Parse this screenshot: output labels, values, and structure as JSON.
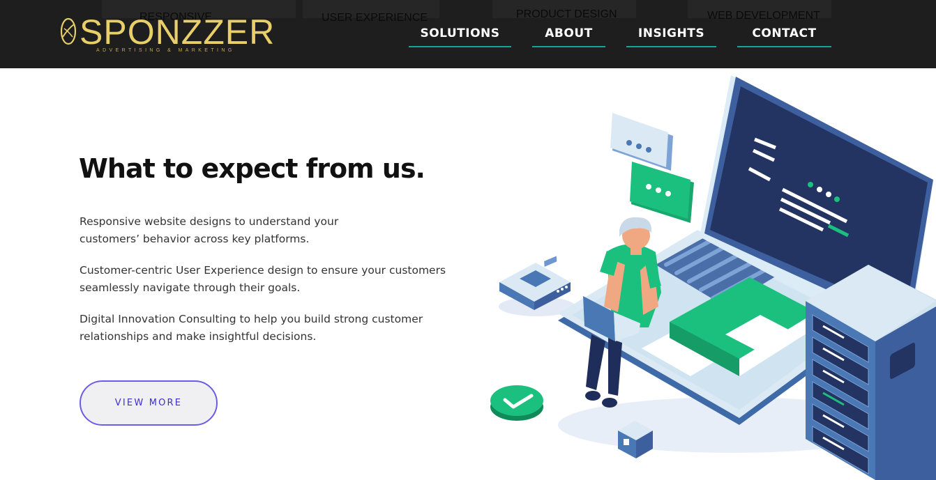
{
  "header": {
    "ghost_labels": [
      "RESPONSIVE",
      "USER EXPERIENCE",
      "PRODUCT DESIGN",
      "WEB DEVELOPMENT"
    ],
    "logo": {
      "name": "SPONZZER",
      "tagline": "ADVERTISING & MARKETING"
    },
    "nav": [
      {
        "label": "SOLUTIONS"
      },
      {
        "label": "ABOUT"
      },
      {
        "label": "INSIGHTS"
      },
      {
        "label": "CONTACT"
      }
    ]
  },
  "main": {
    "title": "What to expect from us.",
    "paragraphs": [
      {
        "line1": "Responsive website designs to understand your",
        "line2": "customers’ behavior across key platforms."
      },
      {
        "line1": "Customer-centric User Experience design to ensure your customers",
        "line2": "seamlessly navigate through their goals."
      },
      {
        "line1": "Digital Innovation Consulting to help you build strong customer",
        "line2": "relationships and make insightful decisions."
      }
    ],
    "cta_label": "VIEW MORE"
  },
  "colors": {
    "header_bg": "#1e1e1e",
    "logo_gold": "#e8cf6a",
    "nav_underline": "#1aa39a",
    "button_border": "#6a5ce6",
    "button_text": "#3b2fd0",
    "illus_navy": "#233463",
    "illus_blue": "#4a78b5",
    "illus_green": "#1cc07e",
    "illus_light": "#cfe3f0"
  },
  "icons": [
    "logo-leaf-icon",
    "chat-bubble-icon",
    "check-badge-icon",
    "server-icon",
    "laptop-icon",
    "router-icon",
    "cube-icon",
    "book-icon"
  ]
}
